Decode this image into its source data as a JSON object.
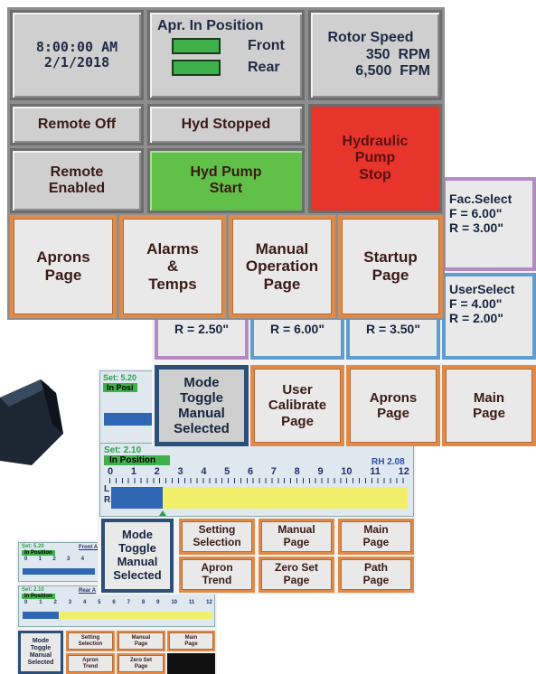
{
  "top_panel": {
    "clock": {
      "time": "8:00:00 AM",
      "date": "2/1/2018"
    },
    "apron_status": {
      "title": "Apr. In Position",
      "front": "Front",
      "rear": "Rear",
      "indicator_color": "#3fb14a"
    },
    "rotor": {
      "title": "Rotor Speed",
      "rpm": "350  RPM",
      "fpm": "6,500  FPM"
    },
    "remote_off": "Remote Off",
    "remote_enabled": "Remote\nEnabled",
    "hyd_stopped": "Hyd Stopped",
    "hyd_pump_start": "Hyd Pump\nStart",
    "hydraulic_pump_stop": "Hydraulic\nPump\nStop",
    "nav": [
      "Aprons\nPage",
      "Alarms\n&\nTemps",
      "Manual\nOperation\nPage",
      "Startup\nPage"
    ],
    "colors": {
      "green": "#61c048",
      "red": "#e8352c",
      "orange_border": "#e08a4a"
    }
  },
  "calibrate_panel": {
    "fac_select": {
      "title": "Fac.Select",
      "f": "F = 6.00\"",
      "r": "R = 3.00\""
    },
    "user_select": {
      "title": "UserSelect",
      "f": "F = 4.00\"",
      "r": "R = 2.00\""
    },
    "partial_values": [
      "R = 2.50\"",
      "R = 6.00\"",
      "R = 3.50\""
    ],
    "buttons": [
      "Mode\nToggle\nManual\nSelected",
      "User\nCalibrate\nPage",
      "Aprons\nPage",
      "Main\nPage"
    ]
  },
  "back_gauge": {
    "set": "Set: 5.20",
    "status": "In Posi"
  },
  "main_gauge": {
    "set": "Set: 2.10",
    "status": "In Position",
    "rh": "RH 2.08",
    "ticks": [
      "0",
      "1",
      "2",
      "3",
      "4",
      "5",
      "6",
      "7",
      "8",
      "9",
      "10",
      "11",
      "12"
    ],
    "l_label": "L",
    "r_label": "R",
    "bar_level_fraction": 0.175
  },
  "manual_panel": {
    "mode_toggle": "Mode\nToggle\nManual\nSelected",
    "buttons": [
      "Setting\nSelection",
      "Manual\nPage",
      "Main\nPage",
      "Apron\nTrend",
      "Zero Set\nPage",
      "Path\nPage"
    ]
  },
  "small_panel": {
    "gauge1": {
      "set": "Set: 5.20",
      "status": "In Position",
      "label": "Front A",
      "ticks": [
        "0",
        "1",
        "2",
        "3",
        "4"
      ]
    },
    "gauge2": {
      "set": "Set: 2.10",
      "status": "In Position",
      "label": "Rear A",
      "ticks": [
        "0",
        "1",
        "2",
        "3",
        "4",
        "5",
        "6",
        "7",
        "8",
        "9",
        "10",
        "11",
        "12"
      ]
    },
    "mode_toggle": "Mode\nToggle\nManual\nSelected",
    "buttons": [
      "Setting\nSelection",
      "Manual\nPage",
      "Main\nPage",
      "Apron\nTrend",
      "Zero Set\nPage"
    ]
  }
}
